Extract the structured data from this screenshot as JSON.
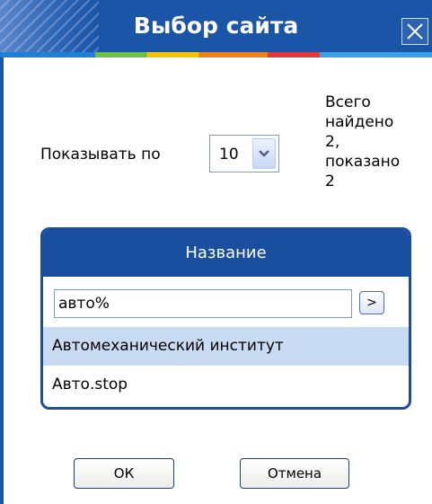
{
  "window": {
    "title": "Выбор сайта",
    "close_icon": "close-icon"
  },
  "options": {
    "show_label": "Показывать по",
    "per_page_value": "10",
    "count_lines": [
      "Всего",
      "найдено",
      "2,",
      "показано",
      "2"
    ]
  },
  "table": {
    "header": "Название",
    "filter_value": "авто%",
    "go_label": ">",
    "rows": [
      {
        "label": "Автомеханический институт",
        "selected": true
      },
      {
        "label": "Авто.stop",
        "selected": false
      }
    ]
  },
  "buttons": {
    "ok_label": "ОК",
    "cancel_label": "Отмена"
  },
  "colors": {
    "titlebar": "#1a55a8",
    "panel_header": "#1a4fa0",
    "selected_row": "#c9daf3"
  }
}
